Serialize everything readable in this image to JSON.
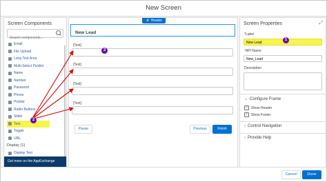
{
  "window": {
    "title": "New Screen"
  },
  "components_panel": {
    "title": "Screen Components",
    "search_placeholder": "Search components...",
    "items": [
      {
        "label": "Email",
        "icon": "email-icon"
      },
      {
        "label": "File Upload",
        "icon": "upload-icon"
      },
      {
        "label": "Long Text Area",
        "icon": "textarea-icon"
      },
      {
        "label": "Multi-Select Picklist",
        "icon": "multiselect-icon"
      },
      {
        "label": "Name",
        "icon": "name-icon"
      },
      {
        "label": "Number",
        "icon": "number-icon"
      },
      {
        "label": "Password",
        "icon": "password-icon"
      },
      {
        "label": "Phone",
        "icon": "phone-icon"
      },
      {
        "label": "Picklist",
        "icon": "picklist-icon"
      },
      {
        "label": "Radio Buttons",
        "icon": "radio-icon"
      },
      {
        "label": "Slider",
        "icon": "slider-icon"
      },
      {
        "label": "Text",
        "icon": "text-icon",
        "selected": true
      },
      {
        "label": "Toggle",
        "icon": "toggle-icon"
      },
      {
        "label": "URL",
        "icon": "url-icon"
      }
    ],
    "display_group": "Display (1)",
    "display_items": [
      {
        "label": "Display Text",
        "icon": "display-text-icon"
      }
    ],
    "appexchange_link": "Get more on the AppExchange"
  },
  "canvas": {
    "header_badge": "Header",
    "header_title": "New Lead",
    "fields": [
      {
        "label": "[Text]"
      },
      {
        "label": "[Text]"
      },
      {
        "label": "[Text]"
      },
      {
        "label": "[Text]"
      }
    ],
    "pause_label": "Pause",
    "previous_label": "Previous",
    "finish_label": "Finish"
  },
  "properties_panel": {
    "title": "Screen Properties",
    "label_field": {
      "label": "Label",
      "value": "New Lead"
    },
    "api_name_field": {
      "label": "API Name",
      "value": "New_Lead"
    },
    "description_label": "Description",
    "configure_frame": {
      "title": "Configure Frame",
      "show_header": {
        "label": "Show Header",
        "checked": true
      },
      "show_footer": {
        "label": "Show Footer",
        "checked": true
      }
    },
    "control_navigation": "Control Navigation",
    "provide_help": "Provide Help"
  },
  "footer": {
    "cancel_label": "Cancel",
    "done_label": "Done"
  },
  "annotations": {
    "one": "1",
    "two": "2",
    "three": "3"
  },
  "colors": {
    "brand": "#0070d2",
    "highlight": "#f7f44a",
    "annotation": "#6a0dad",
    "arrow": "#e00000"
  }
}
